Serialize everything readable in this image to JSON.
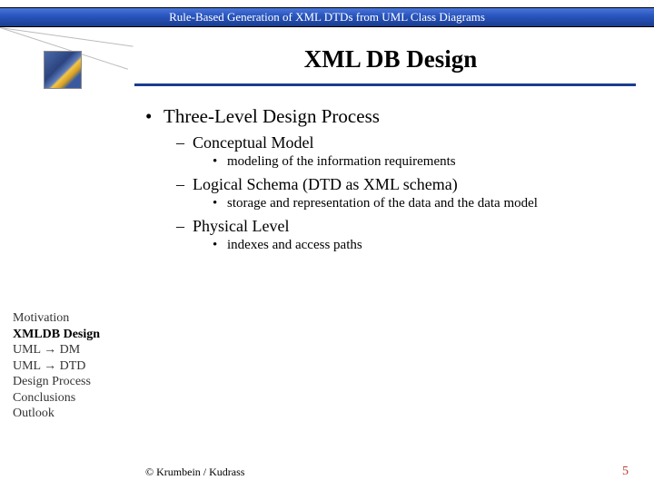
{
  "header": {
    "banner": "Rule-Based Generation of XML DTDs from UML Class Diagrams"
  },
  "title": "XML DB Design",
  "content": {
    "heading": "Three-Level Design Process",
    "items": [
      {
        "label": "Conceptual Model",
        "detail": "modeling of the information requirements"
      },
      {
        "label": "Logical Schema (DTD as XML schema)",
        "detail": "storage and representation of the data and the data model"
      },
      {
        "label": "Physical Level",
        "detail": "indexes and access paths"
      }
    ]
  },
  "sidebar": {
    "items": [
      "Motivation",
      "XMLDB Design",
      "UML → DM",
      "UML → DTD",
      "Design Process",
      "Conclusions",
      "Outlook"
    ],
    "active_index": 1
  },
  "footer": {
    "credit": "© Krumbein / Kudrass",
    "page": "5"
  }
}
